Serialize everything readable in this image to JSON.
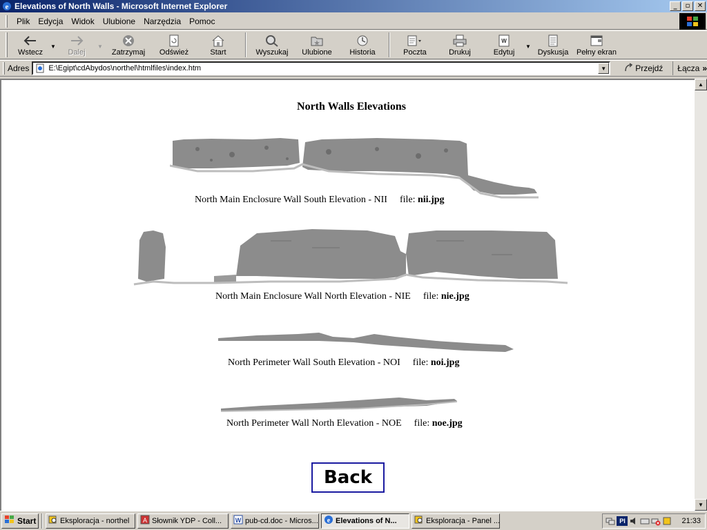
{
  "window": {
    "title": "Elevations of North Walls - Microsoft Internet Explorer",
    "controls": {
      "minimize": "_",
      "maximize": "▫",
      "close": "✕"
    }
  },
  "menu": {
    "items": [
      {
        "label": "Plik"
      },
      {
        "label": "Edycja"
      },
      {
        "label": "Widok"
      },
      {
        "label": "Ulubione"
      },
      {
        "label": "Narzędzia"
      },
      {
        "label": "Pomoc"
      }
    ]
  },
  "toolbar": {
    "back": "Wstecz",
    "forward": "Dalej",
    "stop": "Zatrzymaj",
    "refresh": "Odśwież",
    "home": "Start",
    "search": "Wyszukaj",
    "favorites": "Ulubione",
    "history": "Historia",
    "mail": "Poczta",
    "print": "Drukuj",
    "edit": "Edytuj",
    "discuss": "Dyskusja",
    "fullscreen": "Pełny ekran"
  },
  "address": {
    "label": "Adres",
    "url": "E:\\Egipt\\cdAbydos\\northel\\htmlfiles\\index.htm",
    "go": "Przejdź",
    "links": "Łącza"
  },
  "page": {
    "title": "North Walls  Elevations",
    "elevations": [
      {
        "caption": "North Main Enclosure Wall South Elevation - NII",
        "file_label": "file:",
        "file": "nii.jpg"
      },
      {
        "caption": "North Main Enclosure Wall North Elevation - NIE",
        "file_label": "file:",
        "file": "nie.jpg"
      },
      {
        "caption": "North Perimeter Wall South Elevation - NOI",
        "file_label": "file:",
        "file": "noi.jpg"
      },
      {
        "caption": "North Perimeter Wall North Elevation - NOE",
        "file_label": "file:",
        "file": "noe.jpg"
      }
    ],
    "back": "Back"
  },
  "taskbar": {
    "start": "Start",
    "tasks": [
      {
        "label": "Eksploracja - northel"
      },
      {
        "label": "Słownik YDP  - Coll..."
      },
      {
        "label": "pub-cd.doc - Micros..."
      },
      {
        "label": "Elevations of N..."
      },
      {
        "label": "Eksploracja - Panel ..."
      }
    ],
    "lang": "Pl",
    "clock": "21:33"
  },
  "colors": {
    "titlebar_start": "#0a246a",
    "titlebar_end": "#a6caf0",
    "chrome": "#d4d0c8",
    "back_border": "#1a1aa0",
    "wall_gray": "#8c8c8c"
  }
}
